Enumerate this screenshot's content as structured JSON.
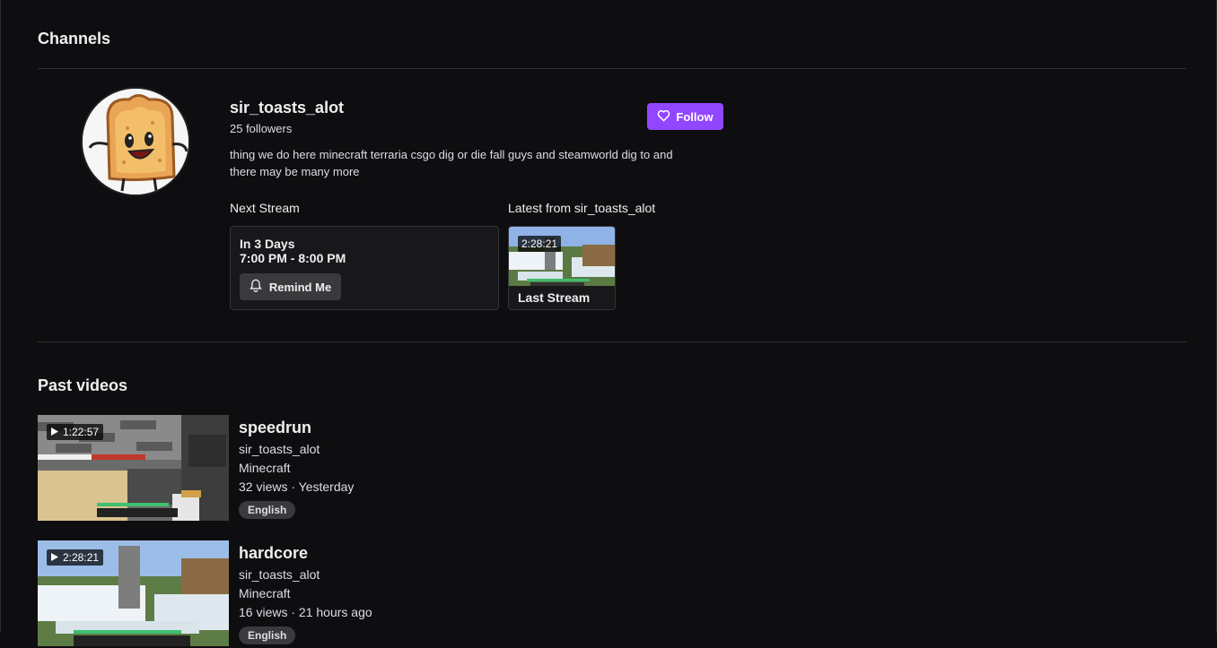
{
  "sections": {
    "channels_title": "Channels",
    "past_videos_title": "Past videos"
  },
  "channel": {
    "name": "sir_toasts_alot",
    "followers": "25 followers",
    "description": "thing we do here minecraft terraria csgo dig or die fall guys and steamworld dig to and there may be many more",
    "follow_label": "Follow",
    "next_stream_heading": "Next Stream",
    "next_stream_when": "In 3 Days",
    "next_stream_time": "7:00 PM - 8:00 PM",
    "remind_label": "Remind Me",
    "latest_heading": "Latest from sir_toasts_alot",
    "latest_duration": "2:28:21",
    "latest_title": "Last Stream"
  },
  "videos": [
    {
      "duration": "1:22:57",
      "title": "speedrun",
      "channel": "sir_toasts_alot",
      "game": "Minecraft",
      "meta": "32 views · Yesterday",
      "tag": "English"
    },
    {
      "duration": "2:28:21",
      "title": "hardcore",
      "channel": "sir_toasts_alot",
      "game": "Minecraft",
      "meta": "16 views · 21 hours ago",
      "tag": "English"
    }
  ],
  "colors": {
    "background": "#0e0e10",
    "accent": "#9147ff",
    "card": "#18181b",
    "button": "#3a3a3d"
  },
  "icons": {
    "follow": "heart-icon",
    "remind": "bell-icon",
    "duration": "play-icon"
  }
}
